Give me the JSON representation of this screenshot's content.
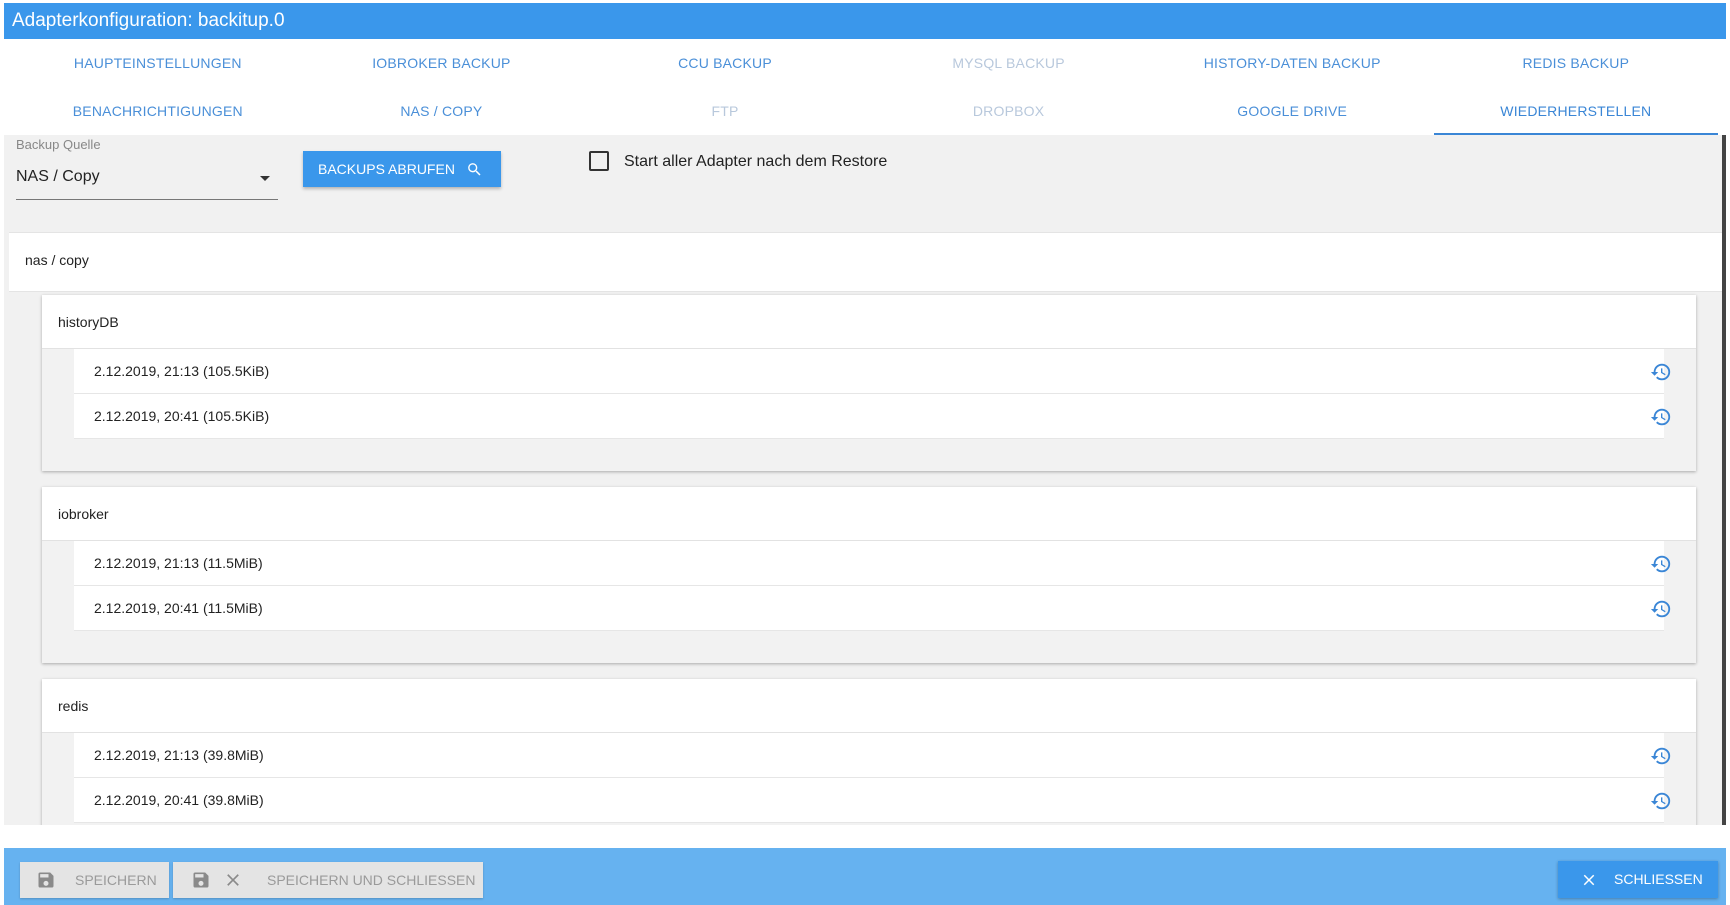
{
  "window": {
    "title": "Adapterkonfiguration: backitup.0"
  },
  "tabs": [
    {
      "label": "HAUPTEINSTELLUNGEN",
      "state": "normal"
    },
    {
      "label": "IOBROKER BACKUP",
      "state": "normal"
    },
    {
      "label": "CCU BACKUP",
      "state": "normal"
    },
    {
      "label": "MYSQL BACKUP",
      "state": "disabled"
    },
    {
      "label": "HISTORY-DATEN BACKUP",
      "state": "normal"
    },
    {
      "label": "REDIS BACKUP",
      "state": "normal"
    },
    {
      "label": "BENACHRICHTIGUNGEN",
      "state": "normal"
    },
    {
      "label": "NAS / COPY",
      "state": "normal"
    },
    {
      "label": "FTP",
      "state": "disabled"
    },
    {
      "label": "DROPBOX",
      "state": "disabled"
    },
    {
      "label": "GOOGLE DRIVE",
      "state": "normal"
    },
    {
      "label": "WIEDERHERSTELLEN",
      "state": "active"
    }
  ],
  "restore": {
    "source_label": "Backup Quelle",
    "source_value": "NAS / Copy",
    "fetch_label": "BACKUPS ABRUFEN",
    "start_adapters_label": "Start aller Adapter nach dem Restore",
    "start_adapters_checked": false
  },
  "location": {
    "title": "nas / copy"
  },
  "groups": [
    {
      "title": "historyDB",
      "entries": [
        "2.12.2019, 21:13 (105.5KiB)",
        "2.12.2019, 20:41 (105.5KiB)"
      ]
    },
    {
      "title": "iobroker",
      "entries": [
        "2.12.2019, 21:13 (11.5MiB)",
        "2.12.2019, 20:41 (11.5MiB)"
      ]
    },
    {
      "title": "redis",
      "entries": [
        "2.12.2019, 21:13 (39.8MiB)",
        "2.12.2019, 20:41 (39.8MiB)"
      ]
    }
  ],
  "footer": {
    "save_label": "SPEICHERN",
    "save_close_label": "SPEICHERN UND SCHLIESSEN",
    "close_label": "SCHLIESSEN"
  },
  "colors": {
    "accent": "#3a97eb",
    "footer": "#66b2f0",
    "disabled_tab": "#b8c8dc"
  },
  "icons": {
    "search": "search-icon",
    "restore": "history-icon",
    "save": "floppy-icon",
    "close": "close-icon",
    "dropdown": "caret-down-icon"
  }
}
